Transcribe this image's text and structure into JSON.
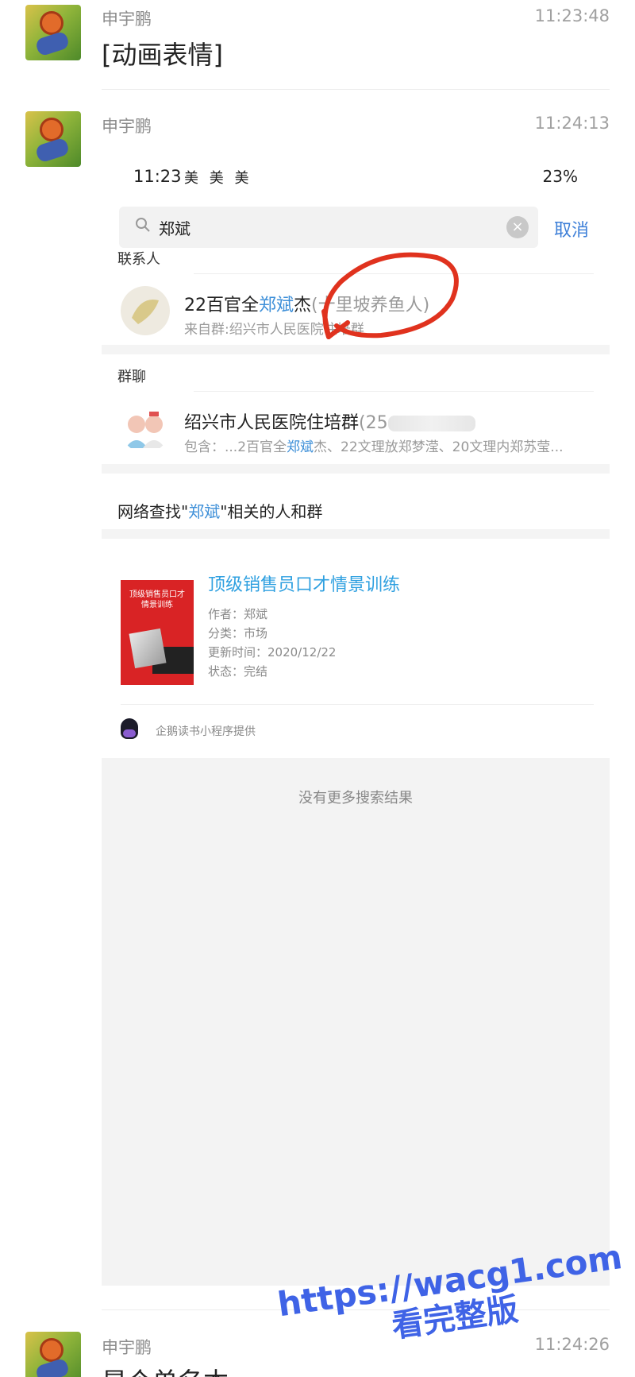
{
  "messages": [
    {
      "sender": "申宇鹏",
      "time": "11:23:48",
      "text": "[动画表情]"
    },
    {
      "sender": "申宇鹏",
      "time": "11:24:13"
    },
    {
      "sender": "申宇鹏",
      "time": "11:24:26",
      "text": "是个单名本"
    }
  ],
  "shot": {
    "status": {
      "time": "11:23",
      "apps": "美 美 美",
      "battery": "23%"
    },
    "search": {
      "query": "郑斌",
      "cancel": "取消"
    },
    "contacts_header": "联系人",
    "contact": {
      "name_prefix": "22百官全",
      "name_hl": "郑斌",
      "name_suffix": "杰",
      "name_paren": "(十里坡养鱼人)",
      "sub": "来自群:绍兴市人民医院住培群"
    },
    "groups_header": "群聊",
    "group": {
      "name": "绍兴市人民医院住培群",
      "count_prefix": "(25",
      "sub_prefix": "包含：...2百官全",
      "sub_hl": "郑斌",
      "sub_suffix": "杰、22文理放郑梦滢、20文理内郑苏莹..."
    },
    "network": {
      "prefix": "网络查找\"",
      "hl": "郑斌",
      "suffix": "\"相关的人和群"
    },
    "book": {
      "cover_title": "顶级销售员口才情景训练",
      "title": "顶级销售员口才情景训练",
      "author": "作者：郑斌",
      "category": "分类：市场",
      "updated": "更新时间：2020/12/22",
      "status": "状态：完结"
    },
    "provider": "企鹅读书小程序提供",
    "no_more": "没有更多搜索结果"
  },
  "watermark": {
    "line1": "https://wacg1.com",
    "line2": "看完整版"
  },
  "colors": {
    "accent": "#3d8fd8",
    "book_link": "#2fa0e0",
    "annotation": "#e0321e",
    "watermark": "#3f63e6"
  }
}
